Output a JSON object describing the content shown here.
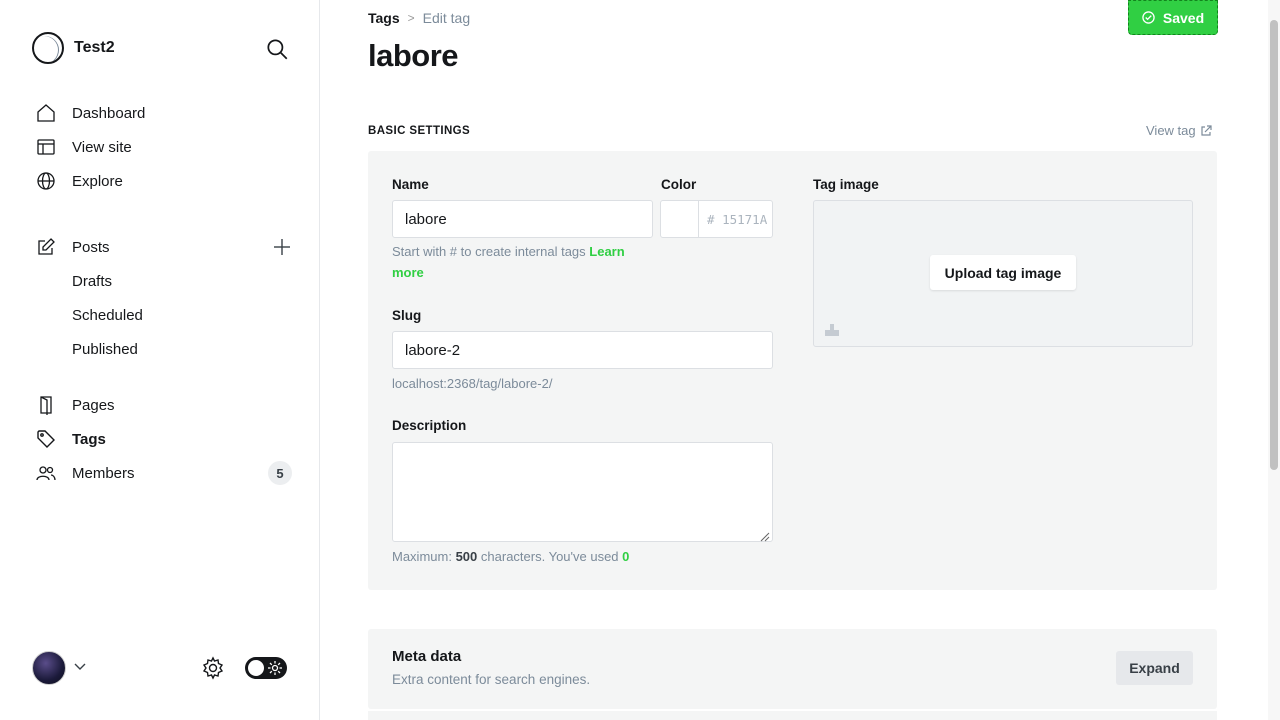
{
  "sidebar": {
    "site_name": "Test2",
    "nav": [
      {
        "label": "Dashboard",
        "icon": "home-icon"
      },
      {
        "label": "View site",
        "icon": "layout-icon"
      },
      {
        "label": "Explore",
        "icon": "globe-icon"
      }
    ],
    "posts": {
      "label": "Posts",
      "icon": "edit-icon"
    },
    "post_sub": [
      "Drafts",
      "Scheduled",
      "Published"
    ],
    "nav2": [
      {
        "label": "Pages",
        "icon": "pages-icon"
      },
      {
        "label": "Tags",
        "icon": "tag-icon",
        "active": true
      },
      {
        "label": "Members",
        "icon": "members-icon",
        "badge": "5"
      }
    ]
  },
  "header": {
    "breadcrumb_parent": "Tags",
    "breadcrumb_sep": ">",
    "breadcrumb_current": "Edit tag",
    "saved_label": "Saved",
    "title": "labore"
  },
  "basic": {
    "section_label": "BASIC SETTINGS",
    "view_tag": "View tag",
    "name_label": "Name",
    "name_value": "labore",
    "name_help": "Start with # to create internal tags",
    "name_help_link": "Learn more",
    "color_label": "Color",
    "color_hash": "#",
    "color_placeholder": "15171A",
    "image_label": "Tag image",
    "upload_label": "Upload tag image",
    "slug_label": "Slug",
    "slug_value": "labore-2",
    "slug_url": "localhost:2368/tag/labore-2/",
    "desc_label": "Description",
    "desc_help_prefix": "Maximum:",
    "desc_max": "500",
    "desc_help_mid": "characters. You've used",
    "desc_used": "0"
  },
  "meta": {
    "title": "Meta data",
    "subtitle": "Extra content for search engines.",
    "expand_label": "Expand"
  },
  "colors": {
    "accent": "#30cf43",
    "text": "#15171a",
    "muted": "#7c8b9a"
  }
}
